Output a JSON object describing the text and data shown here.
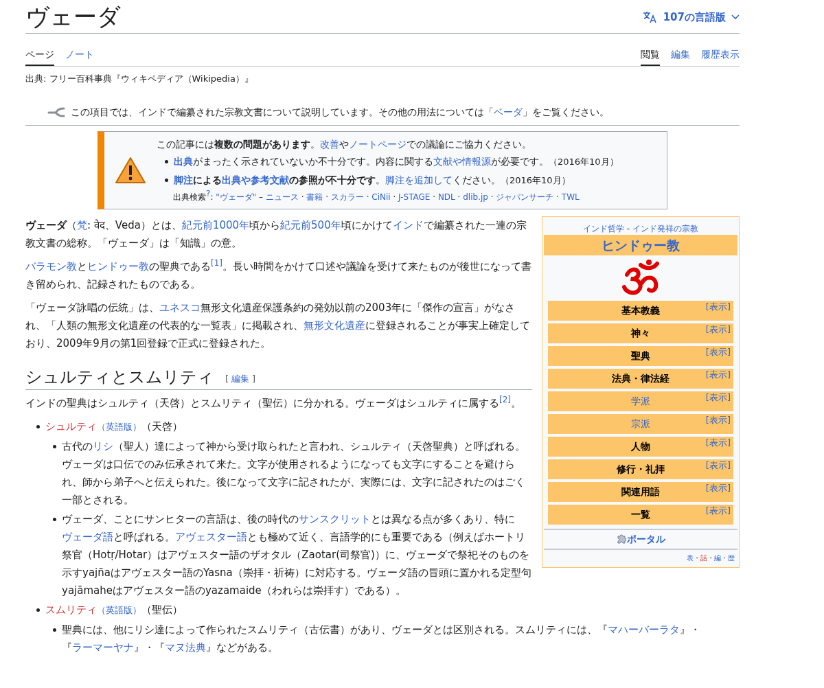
{
  "header": {
    "title": "ヴェーダ",
    "languages": "107の言語版"
  },
  "tabs_left": [
    {
      "label": "ページ",
      "selected": true
    },
    {
      "label": "ノート",
      "selected": false
    }
  ],
  "tabs_right": [
    {
      "label": "閲覧",
      "selected": true
    },
    {
      "label": "編集",
      "selected": false
    },
    {
      "label": "履歴表示",
      "selected": false
    }
  ],
  "source_line": "出典: フリー百科事典『ウィキペディア（Wikipedia）』",
  "hatnote": [
    {
      "kind": "text",
      "text": "この項目では、インドで編纂された宗教文書について説明しています。その他の用法については「"
    },
    {
      "kind": "link",
      "text": "ベーダ"
    },
    {
      "kind": "text",
      "text": "」をご覧ください。"
    }
  ],
  "issues_box": {
    "intro": [
      {
        "kind": "text",
        "text": "この記事には"
      },
      {
        "kind": "bold",
        "text": "複数の問題があります"
      },
      {
        "kind": "text",
        "text": "。"
      },
      {
        "kind": "link",
        "text": "改善"
      },
      {
        "kind": "text",
        "text": "や"
      },
      {
        "kind": "link",
        "text": "ノートページ"
      },
      {
        "kind": "text",
        "text": "での議論にご協力ください。"
      }
    ],
    "items": [
      [
        {
          "kind": "bold_link",
          "text": "出典"
        },
        {
          "kind": "text",
          "text": "がまったく示されていないか不十分です。内容に関する"
        },
        {
          "kind": "link",
          "text": "文献や情報源"
        },
        {
          "kind": "text",
          "text": "が必要です。"
        },
        {
          "kind": "small",
          "text": "（2016年10月）"
        }
      ],
      [
        {
          "kind": "bold_link",
          "text": "脚注"
        },
        {
          "kind": "bold",
          "text": "による"
        },
        {
          "kind": "bold_link",
          "text": "出典や参考文献"
        },
        {
          "kind": "bold",
          "text": "の参照が不十分です"
        },
        {
          "kind": "text",
          "text": "。"
        },
        {
          "kind": "link",
          "text": "脚注を追加して"
        },
        {
          "kind": "text",
          "text": "ください。"
        },
        {
          "kind": "small",
          "text": "（2016年10月）"
        }
      ]
    ],
    "search_line": [
      {
        "kind": "text",
        "text": "出典検索"
      },
      {
        "kind": "ref",
        "text": "?"
      },
      {
        "kind": "text",
        "text": ": "
      },
      {
        "kind": "link",
        "text": "\"ヴェーダ\""
      },
      {
        "kind": "text",
        "text": " – "
      },
      {
        "kind": "link",
        "text": "ニュース"
      },
      {
        "kind": "text",
        "text": " · "
      },
      {
        "kind": "link",
        "text": "書籍"
      },
      {
        "kind": "text",
        "text": " · "
      },
      {
        "kind": "link",
        "text": "スカラー"
      },
      {
        "kind": "text",
        "text": " · "
      },
      {
        "kind": "link",
        "text": "CiNii"
      },
      {
        "kind": "text",
        "text": " · "
      },
      {
        "kind": "link",
        "text": "J-STAGE"
      },
      {
        "kind": "text",
        "text": " · "
      },
      {
        "kind": "link",
        "text": "NDL"
      },
      {
        "kind": "text",
        "text": " · "
      },
      {
        "kind": "link",
        "text": "dlib.jp"
      },
      {
        "kind": "text",
        "text": " · "
      },
      {
        "kind": "link",
        "text": "ジャパンサーチ"
      },
      {
        "kind": "text",
        "text": " · "
      },
      {
        "kind": "link",
        "text": "TWL"
      }
    ]
  },
  "infobox": {
    "above": [
      {
        "kind": "link",
        "text": "インド哲学"
      },
      {
        "kind": "text",
        "text": " - "
      },
      {
        "kind": "link",
        "text": "インド発祥の宗教"
      }
    ],
    "title": "ヒンドゥー教",
    "rows": [
      {
        "label": "基本教義",
        "is_link": false,
        "toggle": "[表示]"
      },
      {
        "label": "神々",
        "is_link": false,
        "toggle": "[表示]"
      },
      {
        "label": "聖典",
        "is_link": false,
        "toggle": "[表示]"
      },
      {
        "label": "法典・律法経",
        "is_link": false,
        "toggle": "[表示]"
      },
      {
        "label": "学派",
        "is_link": true,
        "toggle": "[表示]"
      },
      {
        "label": "宗派",
        "is_link": true,
        "toggle": "[表示]"
      },
      {
        "label": "人物",
        "is_link": false,
        "toggle": "[表示]"
      },
      {
        "label": "修行・礼拝",
        "is_link": false,
        "toggle": "[表示]"
      },
      {
        "label": "関連用語",
        "is_link": false,
        "toggle": "[表示]"
      },
      {
        "label": "一覧",
        "is_link": false,
        "toggle": "[表示]"
      }
    ],
    "portal": "ポータル",
    "footer": [
      {
        "kind": "link",
        "text": "表"
      },
      {
        "kind": "text",
        "text": "・"
      },
      {
        "kind": "red_link",
        "text": "話"
      },
      {
        "kind": "text",
        "text": "・"
      },
      {
        "kind": "link",
        "text": "編"
      },
      {
        "kind": "text",
        "text": "・"
      },
      {
        "kind": "link",
        "text": "歴"
      }
    ]
  },
  "intro_paragraphs": [
    [
      {
        "kind": "bold",
        "text": "ヴェーダ"
      },
      {
        "kind": "text",
        "text": "（"
      },
      {
        "kind": "link",
        "text": "梵"
      },
      {
        "kind": "text",
        "text": ": वेद、Veda）とは、"
      },
      {
        "kind": "link",
        "text": "紀元前1000年"
      },
      {
        "kind": "text",
        "text": "頃から"
      },
      {
        "kind": "link",
        "text": "紀元前500年"
      },
      {
        "kind": "text",
        "text": "頃にかけて"
      },
      {
        "kind": "link",
        "text": "インド"
      },
      {
        "kind": "text",
        "text": "で編纂された一連の宗教文書の総称。「ヴェーダ」は「知識」の意。"
      }
    ],
    [
      {
        "kind": "link",
        "text": "バラモン教"
      },
      {
        "kind": "text",
        "text": "と"
      },
      {
        "kind": "link",
        "text": "ヒンドゥー教"
      },
      {
        "kind": "text",
        "text": "の聖典である"
      },
      {
        "kind": "ref",
        "text": "[1]"
      },
      {
        "kind": "text",
        "text": "。長い時間をかけて口述や議論を受けて来たものが後世になって書き留められ、記録されたものである。"
      }
    ],
    [
      {
        "kind": "text",
        "text": "「ヴェーダ詠唱の伝統」は、"
      },
      {
        "kind": "link",
        "text": "ユネスコ"
      },
      {
        "kind": "text",
        "text": "無形文化遺産保護条約の発効以前の2003年に「傑作の宣言」がなされ、「人類の無形文化遺産の代表的な一覧表」に掲載され、"
      },
      {
        "kind": "link",
        "text": "無形文化遺産"
      },
      {
        "kind": "text",
        "text": "に登録されることが事実上確定しており、2009年9月の第1回登録で正式に登録された。"
      }
    ]
  ],
  "section": {
    "heading": "シュルティとスムリティ",
    "edit": {
      "open": "[",
      "label": "編集",
      "close": "]"
    },
    "paragraph": [
      {
        "kind": "text",
        "text": "インドの聖典はシュルティ（天啓）とスムリティ（聖伝）に分かれる。ヴェーダはシュルティに属する"
      },
      {
        "kind": "ref",
        "text": "[2]"
      },
      {
        "kind": "text",
        "text": "。"
      }
    ],
    "list": [
      {
        "segments": [
          {
            "kind": "red_link",
            "text": "シュルティ"
          },
          {
            "kind": "small_link",
            "text": "（英語版）"
          },
          {
            "kind": "text",
            "text": "（天啓）"
          }
        ],
        "children": [
          {
            "segments": [
              {
                "kind": "text",
                "text": "古代の"
              },
              {
                "kind": "link",
                "text": "リシ"
              },
              {
                "kind": "text",
                "text": "（聖人）達によって神から受け取られたと言われ、シュルティ（天啓聖典）と呼ばれる。ヴェーダは口伝でのみ伝承されて来た。文字が使用されるようになっても文字にすることを避けられ、師から弟子へと伝えられた。後になって文字に記されたが、実際には、文字に記されたのはごく一部とされる。"
              }
            ]
          },
          {
            "segments": [
              {
                "kind": "text",
                "text": "ヴェーダ、ことにサンヒターの言語は、後の時代の"
              },
              {
                "kind": "link",
                "text": "サンスクリット"
              },
              {
                "kind": "text",
                "text": "とは異なる点が多くあり、特に"
              },
              {
                "kind": "link",
                "text": "ヴェーダ語"
              },
              {
                "kind": "text",
                "text": "と呼ばれる。"
              },
              {
                "kind": "link",
                "text": "アヴェスター語"
              },
              {
                "kind": "text",
                "text": "とも極めて近く、言語学的にも重要である（例えばホートリ祭官（Hotṛ/Hotar）はアヴェスター語のザオタル（Zaotar(司祭官)）に、ヴェーダで祭祀そのものを示すyajñaはアヴェスター語のYasna（崇拝・祈祷）に対応する。ヴェーダ語の冒頭に置かれる定型句yajāmaheはアヴェスター語のyazamaide（われらは崇拝す）である）。"
              }
            ]
          }
        ]
      },
      {
        "segments": [
          {
            "kind": "red_link",
            "text": "スムリティ"
          },
          {
            "kind": "small_link",
            "text": "（英語版）"
          },
          {
            "kind": "text",
            "text": "（聖伝）"
          }
        ],
        "children": [
          {
            "segments": [
              {
                "kind": "text",
                "text": "聖典には、他にリシ達によって作られたスムリティ（古伝書）があり、ヴェーダとは区別される。スムリティには、『"
              },
              {
                "kind": "link",
                "text": "マハーバーラタ"
              },
              {
                "kind": "text",
                "text": "』・『"
              },
              {
                "kind": "link",
                "text": "ラーマーヤナ"
              },
              {
                "kind": "text",
                "text": "』・『"
              },
              {
                "kind": "link",
                "text": "マヌ法典"
              },
              {
                "kind": "text",
                "text": "』などがある。"
              }
            ]
          }
        ]
      }
    ]
  }
}
